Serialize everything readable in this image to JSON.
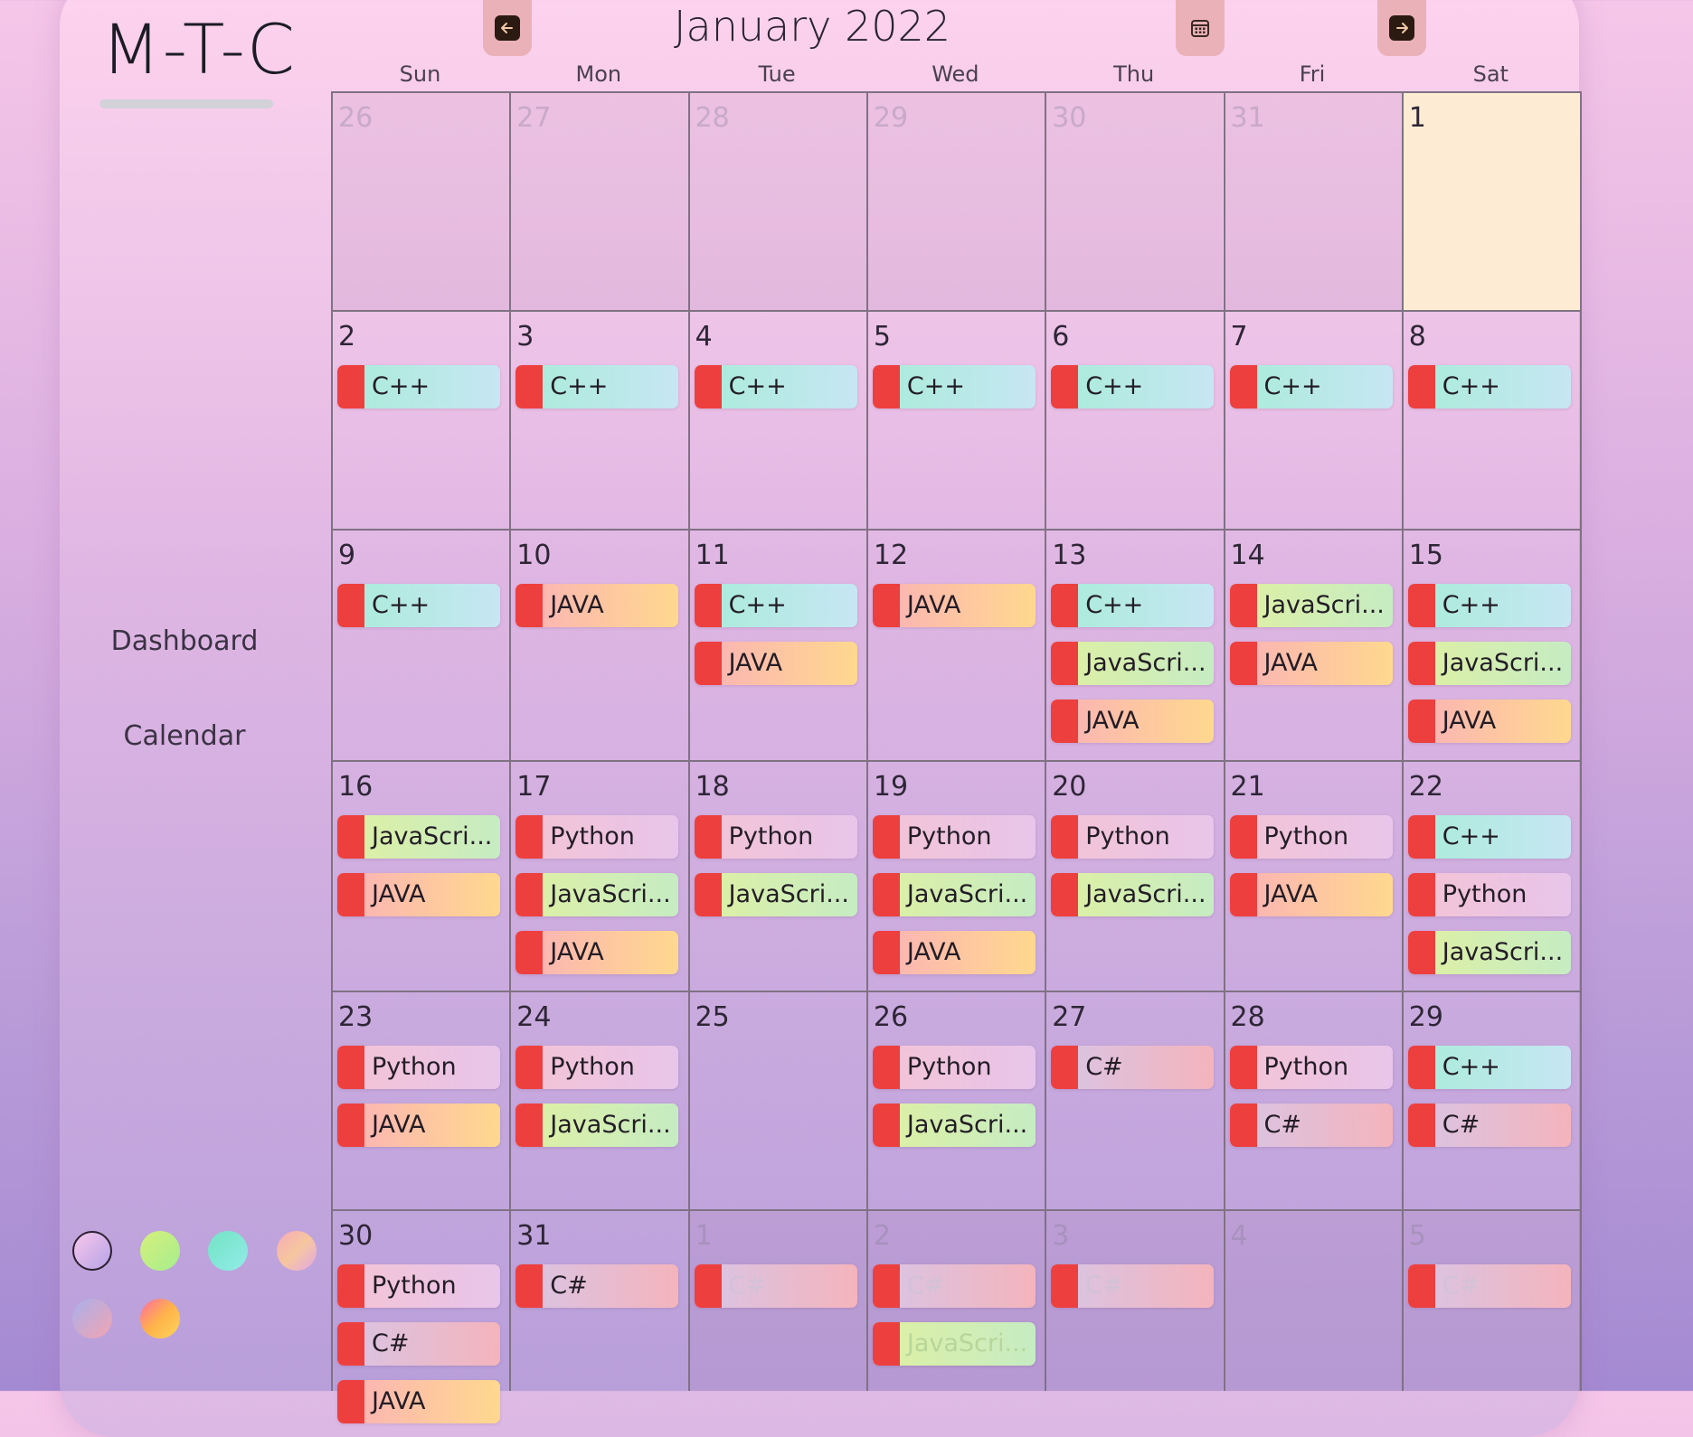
{
  "app": {
    "logo": "M-T-C"
  },
  "sidebar": {
    "nav": [
      {
        "label": "Dashboard"
      },
      {
        "label": "Calendar"
      }
    ]
  },
  "header": {
    "month_title": "January 2022"
  },
  "weekdays": [
    "Sun",
    "Mon",
    "Tue",
    "Wed",
    "Thu",
    "Fri",
    "Sat"
  ],
  "theme_swatches": [
    "pink-purple",
    "lime-green",
    "teal-cyan",
    "peach-pink",
    "lavender-rose",
    "orange-sunset"
  ],
  "courses": {
    "cpp": {
      "label": "C++"
    },
    "java": {
      "label": "JAVA"
    },
    "js": {
      "label": "JavaScri..."
    },
    "py": {
      "label": "Python"
    },
    "cs": {
      "label": "C#"
    }
  },
  "weeks": [
    [
      {
        "day": "26",
        "outside": true,
        "events": []
      },
      {
        "day": "27",
        "outside": true,
        "events": []
      },
      {
        "day": "28",
        "outside": true,
        "events": []
      },
      {
        "day": "29",
        "outside": true,
        "events": []
      },
      {
        "day": "30",
        "outside": true,
        "events": []
      },
      {
        "day": "31",
        "outside": true,
        "events": []
      },
      {
        "day": "1",
        "today": true,
        "events": []
      }
    ],
    [
      {
        "day": "2",
        "events": [
          "cpp"
        ]
      },
      {
        "day": "3",
        "events": [
          "cpp"
        ]
      },
      {
        "day": "4",
        "events": [
          "cpp"
        ]
      },
      {
        "day": "5",
        "events": [
          "cpp"
        ]
      },
      {
        "day": "6",
        "events": [
          "cpp"
        ]
      },
      {
        "day": "7",
        "events": [
          "cpp"
        ]
      },
      {
        "day": "8",
        "events": [
          "cpp"
        ]
      }
    ],
    [
      {
        "day": "9",
        "events": [
          "cpp"
        ]
      },
      {
        "day": "10",
        "events": [
          "java"
        ]
      },
      {
        "day": "11",
        "events": [
          "cpp",
          "java"
        ]
      },
      {
        "day": "12",
        "events": [
          "java"
        ]
      },
      {
        "day": "13",
        "events": [
          "cpp",
          "js",
          "java"
        ]
      },
      {
        "day": "14",
        "events": [
          "js",
          "java"
        ]
      },
      {
        "day": "15",
        "events": [
          "cpp",
          "js",
          "java"
        ]
      }
    ],
    [
      {
        "day": "16",
        "events": [
          "js",
          "java"
        ]
      },
      {
        "day": "17",
        "events": [
          "py",
          "js",
          "java"
        ]
      },
      {
        "day": "18",
        "events": [
          "py",
          "js"
        ]
      },
      {
        "day": "19",
        "events": [
          "py",
          "js",
          "java"
        ]
      },
      {
        "day": "20",
        "events": [
          "py",
          "js"
        ]
      },
      {
        "day": "21",
        "events": [
          "py",
          "java"
        ]
      },
      {
        "day": "22",
        "events": [
          "cpp",
          "py",
          "js"
        ]
      }
    ],
    [
      {
        "day": "23",
        "events": [
          "py",
          "java"
        ]
      },
      {
        "day": "24",
        "events": [
          "py",
          "js"
        ]
      },
      {
        "day": "25",
        "events": []
      },
      {
        "day": "26",
        "events": [
          "py",
          "js"
        ]
      },
      {
        "day": "27",
        "events": [
          "cs"
        ]
      },
      {
        "day": "28",
        "events": [
          "py",
          "cs"
        ]
      },
      {
        "day": "29",
        "events": [
          "cpp",
          "cs"
        ]
      }
    ],
    [
      {
        "day": "30",
        "events": [
          "py",
          "cs",
          "java"
        ]
      },
      {
        "day": "31",
        "events": [
          "cs"
        ]
      },
      {
        "day": "1",
        "outside": true,
        "events": [
          "cs"
        ]
      },
      {
        "day": "2",
        "outside": true,
        "events": [
          "cs",
          "js"
        ]
      },
      {
        "day": "3",
        "outside": true,
        "events": [
          "cs"
        ]
      },
      {
        "day": "4",
        "outside": true,
        "events": []
      },
      {
        "day": "5",
        "outside": true,
        "events": [
          "cs"
        ]
      }
    ]
  ]
}
